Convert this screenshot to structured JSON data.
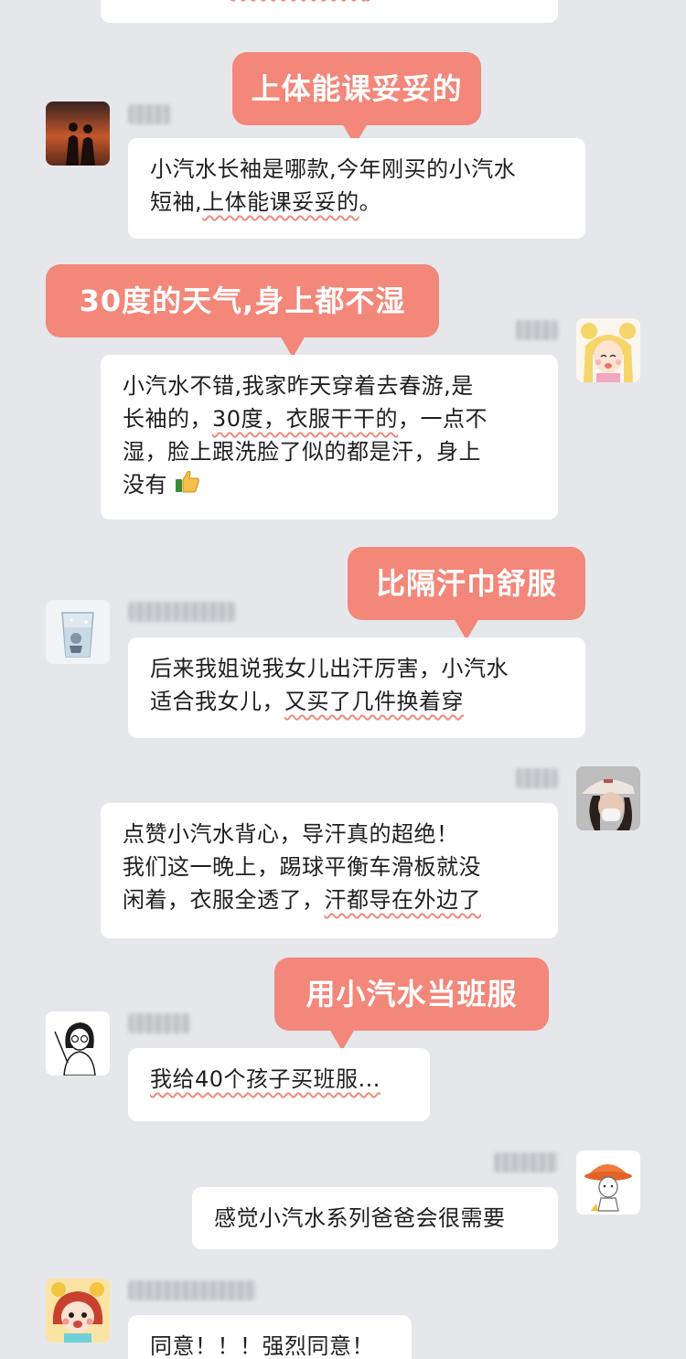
{
  "colors": {
    "background": "#e6e7eb",
    "bubble": "#ffffff",
    "callout": "#f2877a",
    "underline": "#ef8a7c"
  },
  "top_bubble_tail": ",",
  "messages": [
    {
      "id": "m1",
      "side": "left",
      "avatar_icon": "couple-sunset-avatar-icon",
      "callout": "上体能课妥妥的",
      "lines": [
        "小汽水长袖是哪款,今年刚买的小汽水",
        "短袖,",
        "上体能课妥妥的",
        "。"
      ]
    },
    {
      "id": "m2",
      "side": "right",
      "avatar_icon": "sailor-moon-avatar-icon",
      "callout": "30度的天气,身上都不湿",
      "lines": [
        "小汽水不错,我家昨天穿着去春游,是",
        "长袖的，",
        "30度，衣服干干的",
        "，一点不",
        "湿，脸上跟洗脸了似的都是汗，身上",
        "没有"
      ],
      "emoji": "thumbs-up-icon"
    },
    {
      "id": "m3",
      "side": "left",
      "avatar_icon": "water-glass-avatar-icon",
      "callout": "比隔汗巾舒服",
      "lines": [
        "后来我姐说我女儿出汗厉害，小汽水",
        "适合我女儿，",
        "又买了几件换着穿"
      ]
    },
    {
      "id": "m4",
      "side": "right",
      "avatar_icon": "girl-cap-avatar-icon",
      "lines": [
        "点赞小汽水背心，导汗真的超绝！",
        "我们这一晚上，踢球平衡车滑板就没",
        "闲着，衣服全透了，",
        "汗都导在外边了"
      ]
    },
    {
      "id": "m5",
      "side": "left",
      "avatar_icon": "teacher-cartoon-avatar-icon",
      "callout": "用小汽水当班服",
      "lines": [
        "我给40个孩子买班服..."
      ]
    },
    {
      "id": "m6",
      "side": "right",
      "avatar_icon": "orange-hat-avatar-icon",
      "lines": [
        "感觉小汽水系列爸爸会很需要"
      ]
    },
    {
      "id": "m7",
      "side": "left",
      "avatar_icon": "red-hair-girl-avatar-icon",
      "lines": [
        "同意！！！强烈同意！"
      ]
    }
  ]
}
